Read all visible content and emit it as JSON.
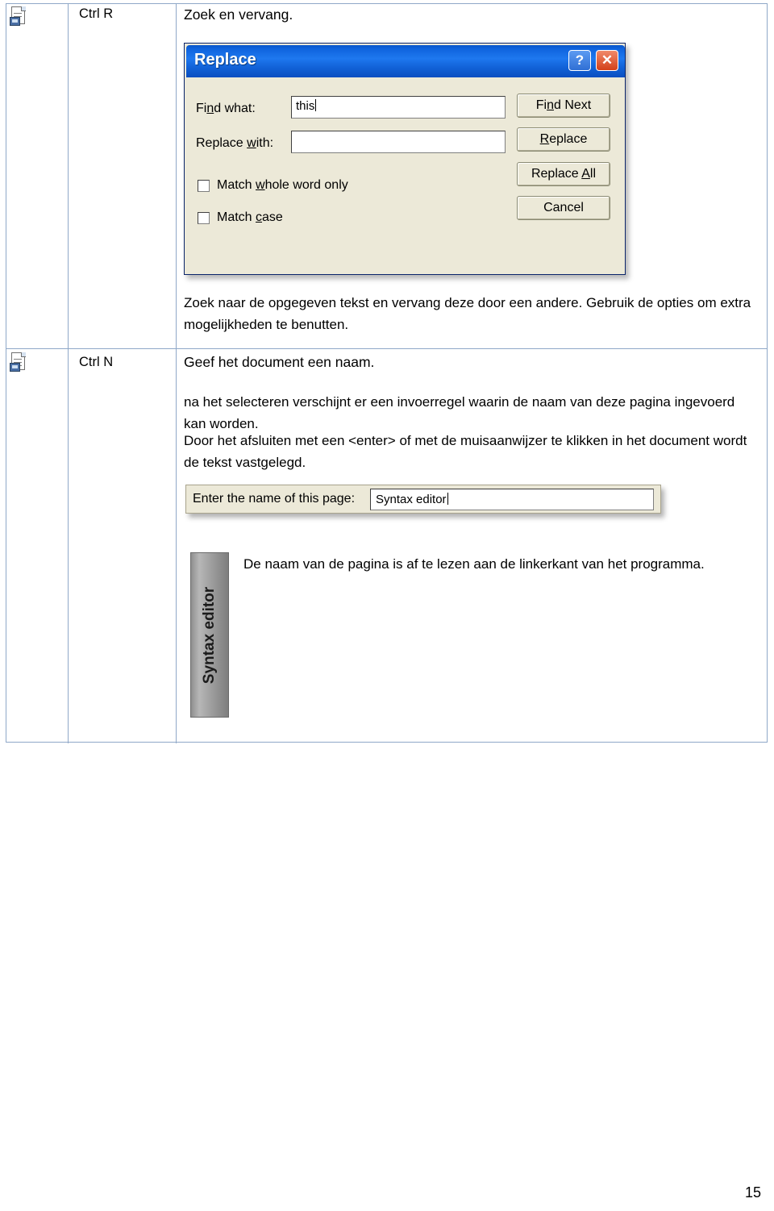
{
  "table": {
    "rows": [
      {
        "icon": "document-save-icon",
        "shortcut": "Ctrl R",
        "heading": "Zoek en vervang.",
        "caption": "Zoek naar de opgegeven tekst en vervang deze door een andere. Gebruik de opties om extra mogelijkheden te benutten."
      },
      {
        "icon": "document-new-icon",
        "shortcut": "Ctrl N",
        "heading": "Geef het document een naam.",
        "paragraph_1": "na het selecteren verschijnt er een invoerregel waarin de naam van deze pagina ingevoerd kan worden.",
        "paragraph_2": "Door het afsluiten met een <enter>  of met de muisaanwijzer te klikken in het document wordt de tekst vastgelegd.",
        "paragraph_3": "De naam van de pagina is af te lezen aan de linkerkant van het programma."
      }
    ]
  },
  "replace_dialog": {
    "title": "Replace",
    "help_button": "?",
    "close_button": "✕",
    "find_label_pre": "Fi",
    "find_label_underline": "n",
    "find_label_post": "d what:",
    "find_value": "this",
    "replace_label_pre": "Replace ",
    "replace_label_underline": "w",
    "replace_label_post": "ith:",
    "replace_value": "",
    "checkbox_whole_word_pre": "Match ",
    "checkbox_whole_word_underline": "w",
    "checkbox_whole_word_post": "hole word only",
    "checkbox_case_pre": "Match ",
    "checkbox_case_underline": "c",
    "checkbox_case_post": "ase",
    "buttons": [
      {
        "pre": "Fi",
        "key": "n",
        "post": "d Next"
      },
      {
        "pre": "",
        "key": "R",
        "post": "eplace"
      },
      {
        "pre": "Replace ",
        "key": "A",
        "post": "ll"
      },
      {
        "pre": "Cancel",
        "key": "",
        "post": ""
      }
    ]
  },
  "name_widget": {
    "label": "Enter the name of this page:",
    "value": "Syntax editor"
  },
  "vertical_tab": {
    "label": "Syntax editor"
  },
  "footer": {
    "page_number": "15"
  }
}
